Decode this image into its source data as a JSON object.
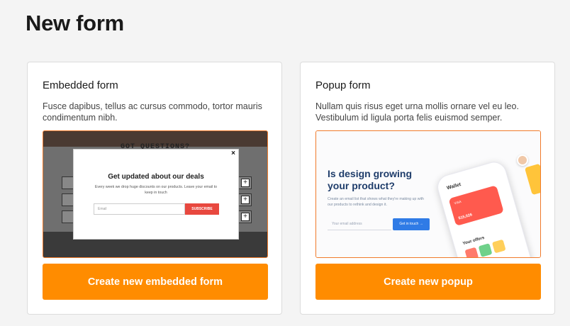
{
  "page": {
    "title": "New form"
  },
  "embedded": {
    "title": "Embedded form",
    "description": "Fusce dapibus, tellus ac cursus commodo, tortor mauris condimentum nibh.",
    "cta": "Create new embedded form",
    "preview": {
      "background_title": "GOT QUESTIONS?",
      "close": "×",
      "plus": "+",
      "modal_title": "Get updated about our deals",
      "modal_body": "Every week we drop huge discounts on our products. Leave your email to keep in touch",
      "input_placeholder": "Email",
      "submit_label": "SUBSCRIBE"
    }
  },
  "popup": {
    "title": "Popup form",
    "description": "Nullam quis risus eget urna mollis ornare vel eu leo. Vestibulum id ligula porta felis euismod semper.",
    "cta": "Create new popup",
    "preview": {
      "heading": "Is design growing your product?",
      "subtext": "Create an email list that shows what they're making up with our products to rethink and design it.",
      "input_placeholder": "Your email address",
      "button_label": "Get in touch  →",
      "wallet_label": "Wallet",
      "card_label": "VISA",
      "card_value": "$15,026",
      "offers_label": "Your offers"
    }
  },
  "colors": {
    "accent": "#ff8c00",
    "preview_border": "#f07a2a",
    "popup_heading": "#1f3d6b",
    "subscribe": "#e8483f",
    "popup_button": "#2f7be6"
  }
}
